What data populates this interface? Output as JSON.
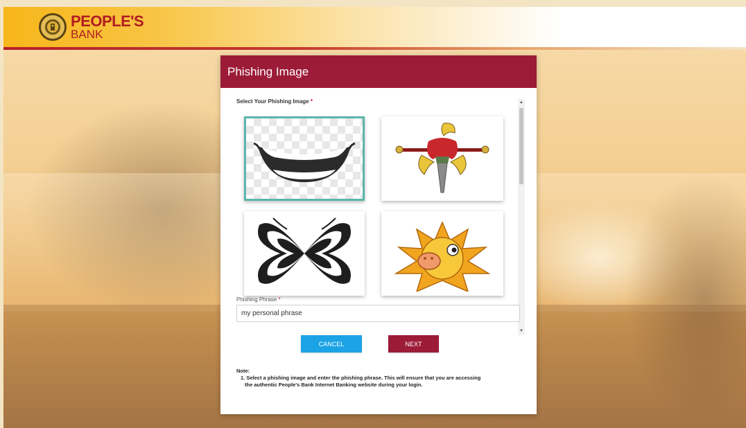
{
  "brand": {
    "name": "PEOPLE'S",
    "subtitle": "BANK",
    "primary_color": "#9c1c38",
    "accent_color": "#1ba3e6"
  },
  "dialog": {
    "title": "Phishing Image",
    "image_section": {
      "label": "Select Your Phishing Image",
      "required_mark": "*",
      "images": [
        {
          "icon": "smile-mouth-icon",
          "selected": true
        },
        {
          "icon": "heraldic-emblem-icon",
          "selected": false
        },
        {
          "icon": "butterfly-icon",
          "selected": false
        },
        {
          "icon": "sun-face-icon",
          "selected": false
        }
      ]
    },
    "phrase": {
      "label": "Phishing Phrase",
      "required_mark": "*",
      "value": "my personal phrase"
    },
    "buttons": {
      "cancel": "CANCEL",
      "next": "NEXT"
    },
    "note": {
      "title": "Note:",
      "item_1": "1. Select a phishing image and enter the phishing phrase. This will ensure that you are accessing",
      "item_1_cont": "the authentic People's Bank Internet Banking website during your login."
    }
  }
}
